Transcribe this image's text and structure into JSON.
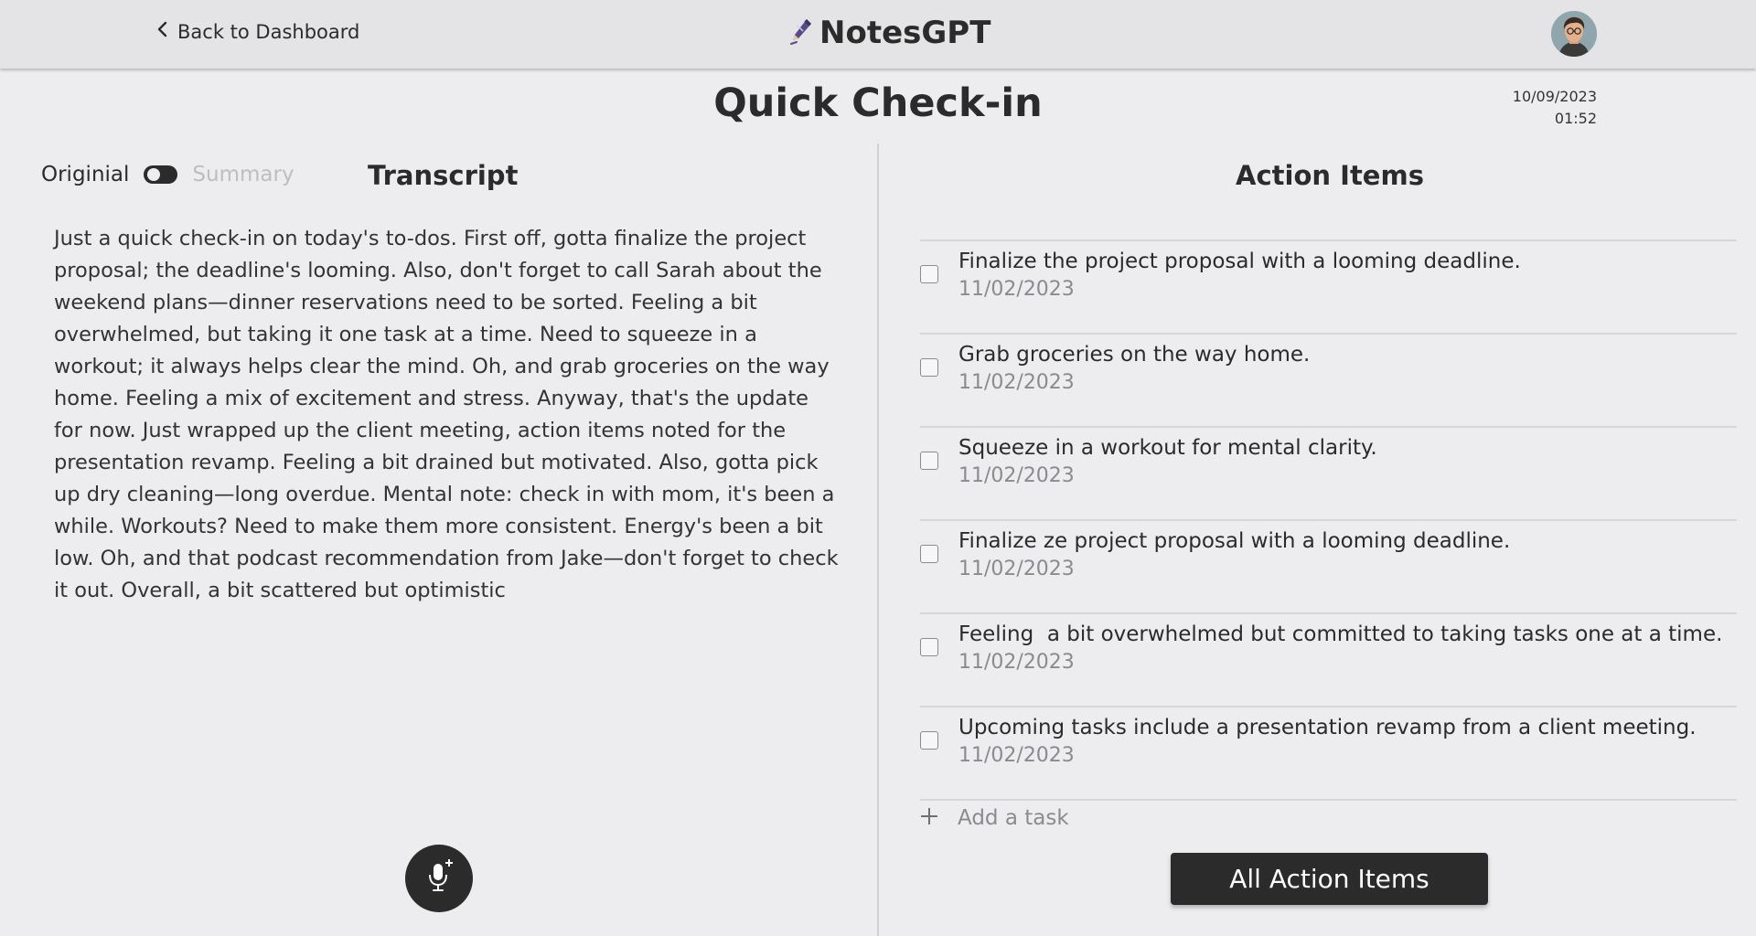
{
  "header": {
    "back_label": "Back to Dashboard",
    "brand_name": "NotesGPT",
    "icons": {
      "back": "chevron-left-icon",
      "brand": "pen-icon",
      "avatar": "user-avatar"
    }
  },
  "note": {
    "title": "Quick Check-in",
    "date": "10/09/2023",
    "time": "01:52"
  },
  "transcript_panel": {
    "toggle_left_label": "Originial",
    "toggle_right_label": "Summary",
    "toggle_state": "Originial",
    "heading": "Transcript",
    "text": "Just a quick check-in on today's to-dos. First off, gotta finalize the project proposal; the deadline's looming. Also, don't forget to call Sarah about the weekend plans—dinner reservations need to be sorted. Feeling a bit overwhelmed, but taking it one task at a time. Need to squeeze in a workout; it always helps clear the mind. Oh, and grab groceries on the way home. Feeling a mix of excitement and stress. Anyway, that's the update for now. Just wrapped up the client meeting, action items noted for the presentation revamp. Feeling a bit drained but motivated. Also, gotta pick up dry cleaning—long overdue. Mental note: check in with mom, it's been a while. Workouts? Need to make them more consistent. Energy's been a bit low. Oh, and that podcast recommendation from Jake—don't forget to check it out. Overall, a bit scattered but optimistic",
    "mic_icon": "microphone-plus-icon"
  },
  "action_panel": {
    "heading": "Action Items",
    "items": [
      {
        "text": "Finalize the project proposal with a looming deadline.",
        "date": "11/02/2023",
        "checked": false
      },
      {
        "text": "Grab groceries on the way home.",
        "date": "11/02/2023",
        "checked": false
      },
      {
        "text": "Squeeze in a workout for mental clarity.",
        "date": "11/02/2023",
        "checked": false
      },
      {
        "text": "Finalize ze project proposal with a looming deadline.",
        "date": "11/02/2023",
        "checked": false
      },
      {
        "text": "Feeling  a bit overwhelmed but committed to taking tasks one at a time.",
        "date": "11/02/2023",
        "checked": false
      },
      {
        "text": "Upcoming tasks include a presentation revamp from a client meeting.",
        "date": "11/02/2023",
        "checked": false
      }
    ],
    "add_task_placeholder": "Add a task",
    "all_items_button": "All Action Items"
  },
  "colors": {
    "background": "#ededf0",
    "topbar": "#e4e4e6",
    "primary_dark": "#2b2b2b",
    "muted_text": "#8a8a8f",
    "disabled_text": "#bdbdc2"
  }
}
